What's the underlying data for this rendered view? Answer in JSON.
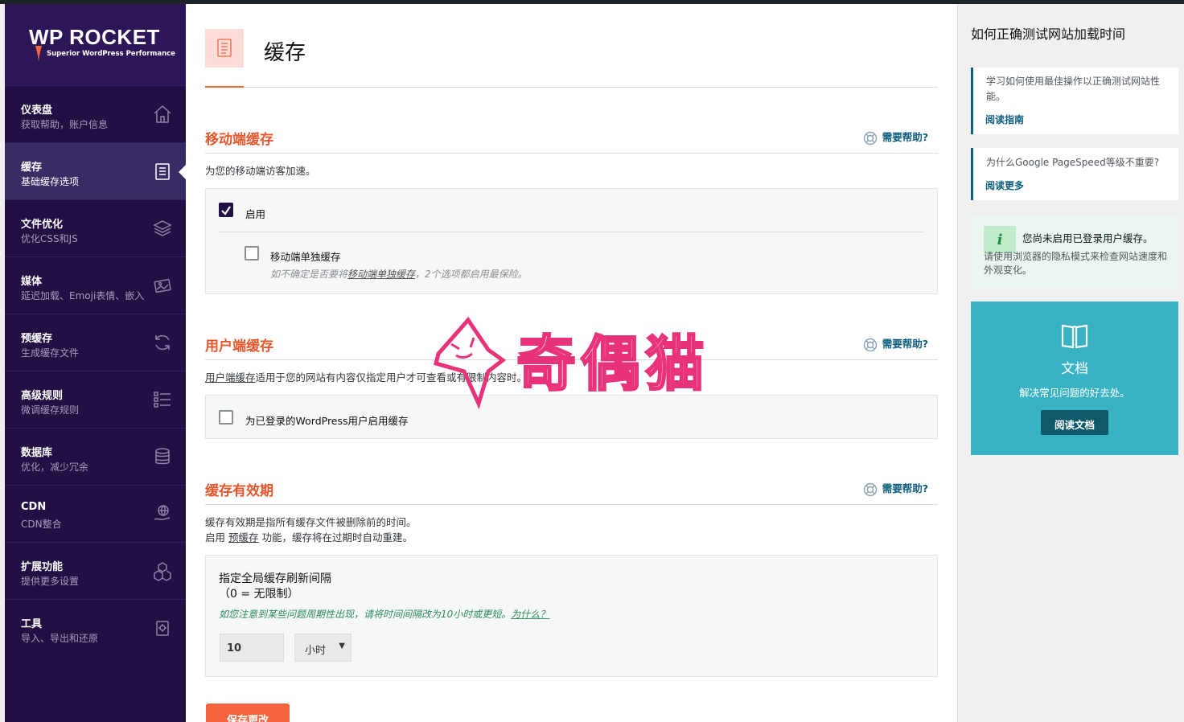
{
  "brand": {
    "name": "WP ROCKET",
    "tagline": "Superior WordPress Performance"
  },
  "sidebar": {
    "items": [
      {
        "title": "仪表盘",
        "sub": "获取帮助，账户信息",
        "icon": "home-icon"
      },
      {
        "title": "缓存",
        "sub": "基础缓存选项",
        "icon": "document-icon",
        "active": true
      },
      {
        "title": "文件优化",
        "sub": "优化CSS和JS",
        "icon": "layers-icon"
      },
      {
        "title": "媒体",
        "sub": "延迟加载、Emoji表情、嵌入",
        "icon": "image-icon"
      },
      {
        "title": "预缓存",
        "sub": "生成缓存文件",
        "icon": "refresh-icon"
      },
      {
        "title": "高级规则",
        "sub": "微调缓存规则",
        "icon": "list-icon"
      },
      {
        "title": "数据库",
        "sub": "优化，减少冗余",
        "icon": "database-icon"
      },
      {
        "title": "CDN",
        "sub": "CDN整合",
        "icon": "globe-hand-icon"
      },
      {
        "title": "扩展功能",
        "sub": "提供更多设置",
        "icon": "cubes-icon"
      },
      {
        "title": "工具",
        "sub": "导入、导出和还原",
        "icon": "tools-icon"
      }
    ]
  },
  "main": {
    "page_title": "缓存",
    "help_label": "需要帮助?",
    "mobile": {
      "title": "移动端缓存",
      "desc": "为您的移动端访客加速。",
      "enable_label": "启用",
      "enable_checked": true,
      "separate_label": "移动端单独缓存",
      "separate_checked": false,
      "note_prefix": "如不确定是否要将",
      "note_link": "移动端单独缓存",
      "note_suffix": "，2个选项都启用最保险。"
    },
    "user": {
      "title": "用户端缓存",
      "desc_link": "用户端缓存",
      "desc_rest": "适用于您的网站有内容仅指定用户才可查看或有限制内容时。",
      "option_label": "为已登录的WordPress用户启用缓存",
      "option_checked": false
    },
    "lifespan": {
      "title": "缓存有效期",
      "desc1": "缓存有效期是指所有缓存文件被删除前的时间。",
      "desc2_prefix": "启用",
      "desc2_link": "预缓存",
      "desc2_suffix": "功能，缓存将在过期时自动重建。",
      "field_label": "指定全局缓存刷新间隔",
      "field_hint": "（0 = 无限制）",
      "field_note_prefix": "如您注意到某些问题周期性出现，请将时间间隔改为10小时或更短。",
      "field_note_link": "为什么？",
      "value": "10",
      "unit": "小时"
    },
    "save_label": "保存更改"
  },
  "watermark": {
    "text": "奇偶猫"
  },
  "right": {
    "title": "如何正确测试网站加载时间",
    "cards": [
      {
        "text": "学习如何使用最佳操作以正确测试网站性能。",
        "link": "阅读指南"
      },
      {
        "text": "为什么Google PageSpeed等级不重要?",
        "link": "阅读更多"
      }
    ],
    "notice": {
      "icon_letter": "i",
      "title": "您尚未启用已登录用户缓存。",
      "text": "请使用浏览器的隐私模式来检查网站速度和外观变化。"
    },
    "docs": {
      "title": "文档",
      "desc": "解决常见问题的好去处。",
      "button": "阅读文档"
    }
  },
  "colors": {
    "sidebar_bg": "#221045",
    "accent_orange": "#f56640",
    "section_title": "#e8562b",
    "link_teal": "#0c5e7f",
    "doc_box": "#39b3c4"
  }
}
